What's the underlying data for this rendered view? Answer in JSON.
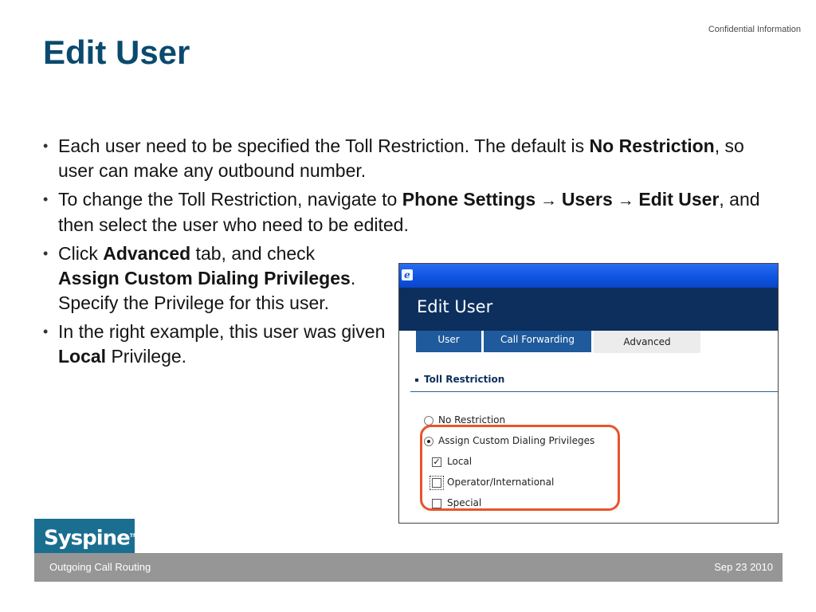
{
  "header": {
    "confidential": "Confidential Information",
    "title": "Edit User"
  },
  "bullets": [
    {
      "segments": [
        {
          "text": "Each user need to be specified the Toll Restriction. The default is ",
          "bold": false
        },
        {
          "text": "No Restriction",
          "bold": true
        },
        {
          "text": ", so user can make any outbound number.",
          "bold": false
        }
      ]
    },
    {
      "segments": [
        {
          "text": "To change the Toll Restriction, navigate to ",
          "bold": false
        },
        {
          "text": "Phone Settings",
          "bold": true
        },
        {
          "text": " → ",
          "bold": true
        },
        {
          "text": "Users",
          "bold": true
        },
        {
          "text": " → ",
          "bold": true
        },
        {
          "text": "Edit User",
          "bold": true
        },
        {
          "text": ", and then select the user who need to be edited.",
          "bold": false
        }
      ]
    },
    {
      "segments": [
        {
          "text": "Click ",
          "bold": false
        },
        {
          "text": "Advanced",
          "bold": true
        },
        {
          "text": " tab, and check ",
          "bold": false
        },
        {
          "text": "Assign Custom Dialing Privileges",
          "bold": true
        },
        {
          "text": ". Specify the Privilege for this user.",
          "bold": false
        }
      ]
    },
    {
      "segments": [
        {
          "text": "In the right example, this user was given ",
          "bold": false
        },
        {
          "text": "Local",
          "bold": true
        },
        {
          "text": " Privilege.",
          "bold": false
        }
      ]
    }
  ],
  "screenshot": {
    "window_icon": "ie-icon",
    "header_title": "Edit User",
    "tabs": [
      {
        "label": "User",
        "active": false
      },
      {
        "label": "Call Forwarding",
        "active": false
      },
      {
        "label": "Advanced",
        "active": true
      }
    ],
    "section_title": "Toll Restriction",
    "radio_options": [
      {
        "label": "No Restriction",
        "selected": false
      },
      {
        "label": "Assign Custom Dialing Privileges",
        "selected": true
      }
    ],
    "privileges": [
      {
        "label": "Local",
        "checked": true
      },
      {
        "label": "Operator/International",
        "checked": false
      },
      {
        "label": "Special",
        "checked": false
      }
    ],
    "highlight_color": "#e8542a"
  },
  "footer": {
    "logo": "Syspine",
    "left": "Outgoing Call Routing",
    "right": "Sep 23 2010"
  },
  "colors": {
    "title": "#0a4a6e",
    "screenshot_header": "#0c2f5e",
    "tab": "#1f5a9c",
    "footer": "#969696",
    "logo_bg": "#1a6e90"
  }
}
